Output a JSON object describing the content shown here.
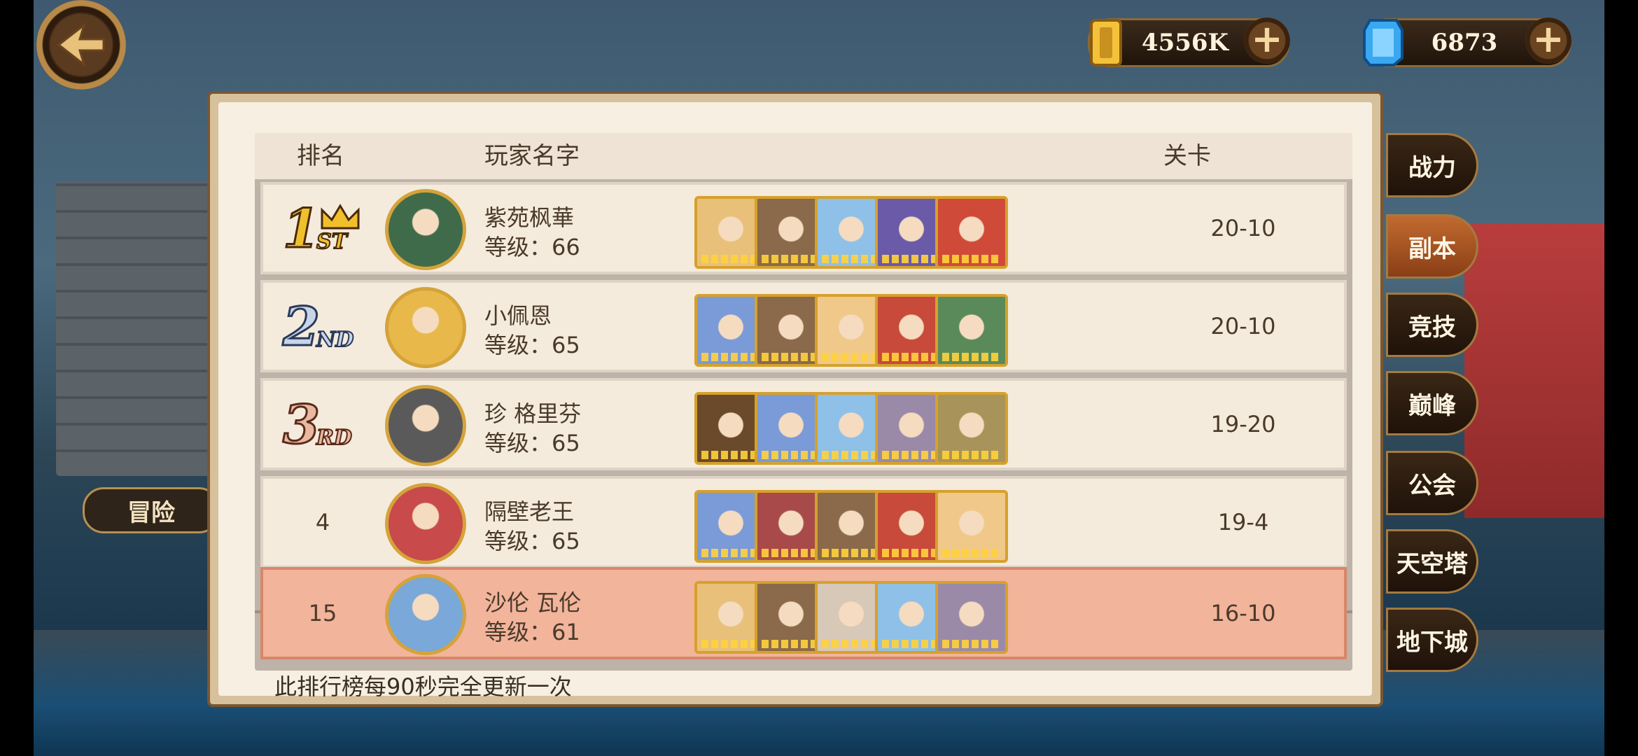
{
  "currency": {
    "gold": {
      "amount": "4556K",
      "icon": "gold-bar-icon"
    },
    "gem": {
      "amount": "6873",
      "icon": "blue-gem-icon"
    }
  },
  "background": {
    "banner_label": "冒险"
  },
  "table": {
    "headers": {
      "rank": "排名",
      "player_name": "玩家名字",
      "stage": "关卡"
    },
    "rows": [
      {
        "rank": "1",
        "badge": [
          "1",
          "ST"
        ],
        "name": "紫苑枫華",
        "level": "等级：66",
        "stage": "20-10",
        "avatar_color": "#3f6b4a",
        "heroes": [
          "#e8c07a",
          "#8a6a4a",
          "#8fc0e8",
          "#6a5aa8",
          "#d04a3a"
        ]
      },
      {
        "rank": "2",
        "badge": [
          "2",
          "ND"
        ],
        "name": "小佩恩",
        "level": "等级：65",
        "stage": "20-10",
        "avatar_color": "#e8b84a",
        "heroes": [
          "#7a9ad8",
          "#8a6a4a",
          "#f0c88a",
          "#c84a3a",
          "#5a8a5a"
        ]
      },
      {
        "rank": "3",
        "badge": [
          "3",
          "RD"
        ],
        "name": "珍 格里芬",
        "level": "等级：65",
        "stage": "19-20",
        "avatar_color": "#5a5a5a",
        "heroes": [
          "#6a4a2a",
          "#7a9ad8",
          "#8fc0e8",
          "#9a8aa8",
          "#a8945a"
        ]
      },
      {
        "rank": "4",
        "name": "隔壁老王",
        "level": "等级：65",
        "stage": "19-4",
        "avatar_color": "#c84a4a",
        "heroes": [
          "#7a9ad8",
          "#a84a4a",
          "#8a6a4a",
          "#c84a3a",
          "#f0c88a"
        ]
      }
    ],
    "self": {
      "rank": "15",
      "name": "沙伦 瓦伦",
      "level": "等级：61",
      "stage": "16-10",
      "avatar_color": "#7aa8d8",
      "heroes": [
        "#e8c07a",
        "#8a6a4a",
        "#d8c8b8",
        "#8fc0e8",
        "#9a8aa8"
      ]
    },
    "footer": "此排行榜每90秒完全更新一次"
  },
  "tabs": [
    {
      "label": "战力",
      "active": false
    },
    {
      "label": "副本",
      "active": true
    },
    {
      "label": "竞技",
      "active": false
    },
    {
      "label": "巅峰",
      "active": false
    },
    {
      "label": "公会",
      "active": false
    },
    {
      "label": "天空塔",
      "active": false
    },
    {
      "label": "地下城",
      "active": false
    }
  ],
  "colors": {
    "gold": "#d4a33a",
    "panel": "#f7efe2",
    "highlight": "#f2b49a",
    "active_tab": "#c26a30"
  }
}
